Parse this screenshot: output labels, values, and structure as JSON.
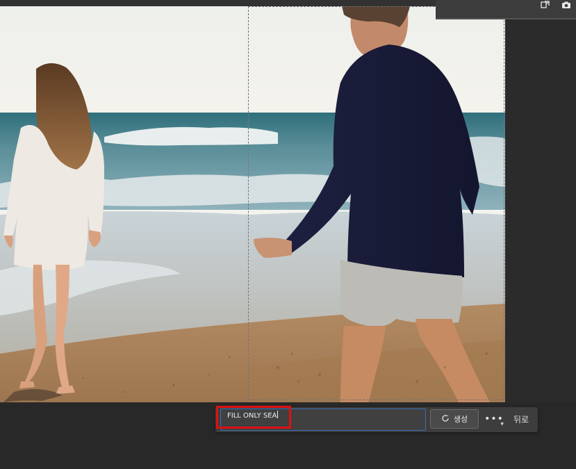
{
  "canvas": {
    "image_description_icon": "photo-canvas"
  },
  "taskbar": {
    "prompt_value": "FILL ONLY SEA",
    "generate_label": "생성",
    "generate_icon": "refresh-sparkle-icon",
    "more_label": "•••",
    "back_label": "뒤로"
  },
  "mini_panel": {
    "icons": [
      "export-icon",
      "camera-icon"
    ]
  },
  "colors": {
    "accent_focus": "#3b6fb8",
    "highlight": "#e01010",
    "background": "#282828",
    "taskbar": "#3d3d3d"
  }
}
